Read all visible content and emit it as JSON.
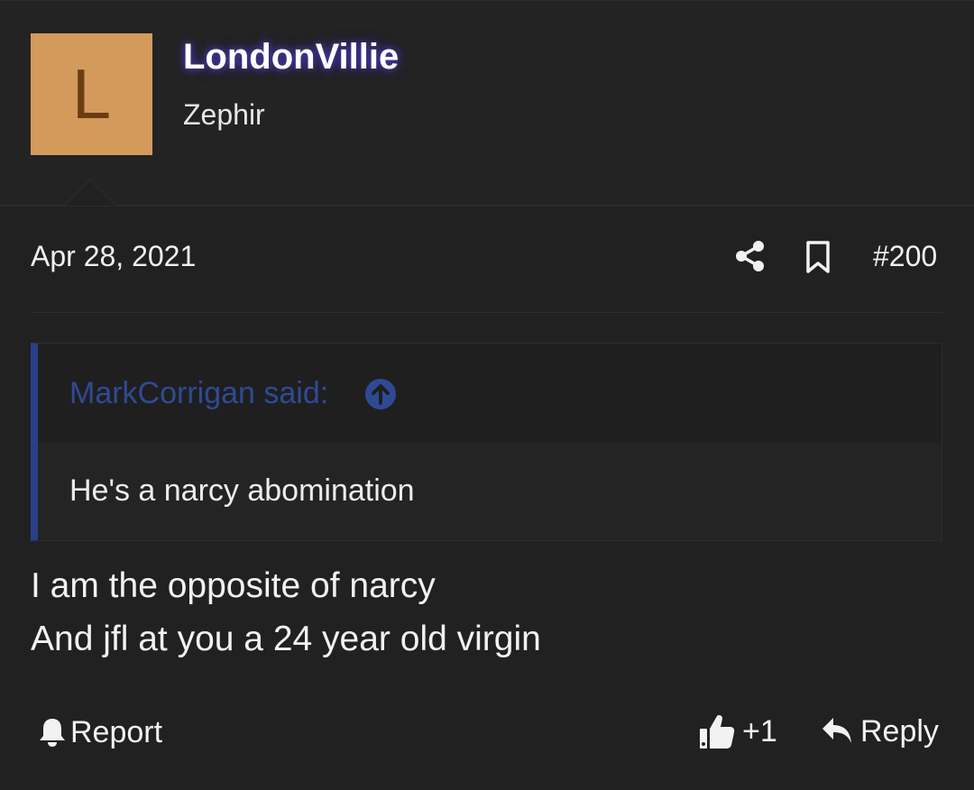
{
  "user": {
    "avatar_letter": "L",
    "avatar_color": "#d39a5c",
    "username": "LondonVillie",
    "title": "Zephir"
  },
  "post": {
    "date": "Apr 28, 2021",
    "number": "#200",
    "share_icon": "share-icon",
    "bookmark_icon": "bookmark-icon"
  },
  "quote": {
    "author": "MarkCorrigan said:",
    "accent_color": "#2a3f8a",
    "body": "He's a narcy abomination"
  },
  "message": {
    "lines": [
      "I am the opposite of narcy",
      "And jfl at you a 24 year old virgin"
    ]
  },
  "actions": {
    "report_label": "Report",
    "like_label": "+1",
    "reply_label": "Reply"
  }
}
